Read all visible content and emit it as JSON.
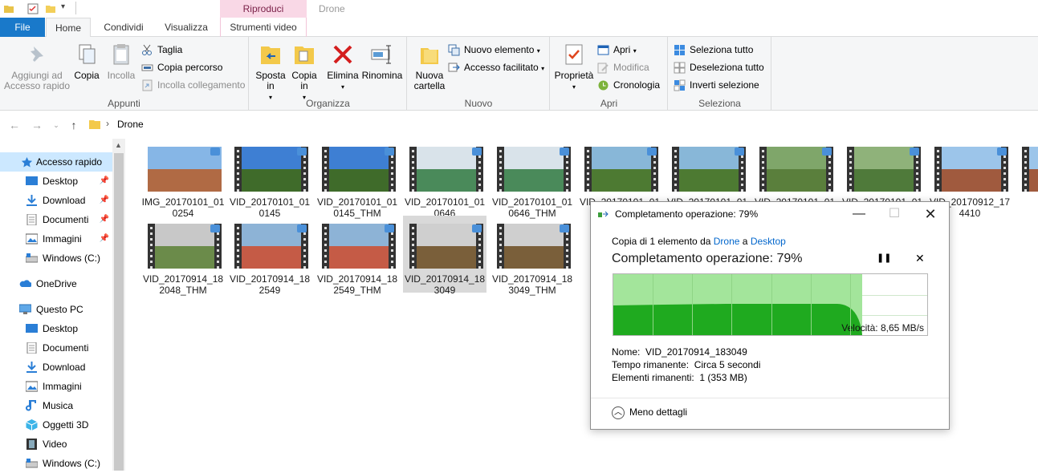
{
  "window": {
    "title": "Drone",
    "context_tab": "Riproduci"
  },
  "tabs": {
    "file": "File",
    "home": "Home",
    "share": "Condividi",
    "view": "Visualizza",
    "video_tools": "Strumenti video"
  },
  "ribbon": {
    "appunti": {
      "label": "Appunti",
      "pin": "Aggiungi ad Accesso rapido",
      "copy": "Copia",
      "paste": "Incolla",
      "cut": "Taglia",
      "copy_path": "Copia percorso",
      "paste_link": "Incolla collegamento"
    },
    "organizza": {
      "label": "Organizza",
      "move": "Sposta in",
      "copy_to": "Copia in",
      "delete": "Elimina",
      "rename": "Rinomina"
    },
    "nuovo": {
      "label": "Nuovo",
      "new_folder": "Nuova cartella",
      "new_item": "Nuovo elemento",
      "easy_access": "Accesso facilitato"
    },
    "apri": {
      "label": "Apri",
      "properties": "Proprietà",
      "open": "Apri",
      "edit": "Modifica",
      "history": "Cronologia"
    },
    "seleziona": {
      "label": "Seleziona",
      "select_all": "Seleziona tutto",
      "select_none": "Deseleziona tutto",
      "invert": "Inverti selezione"
    }
  },
  "address": {
    "path": "Drone"
  },
  "nav": {
    "quick_access": "Accesso rapido",
    "qa_items": [
      "Desktop",
      "Download",
      "Documenti",
      "Immagini",
      "Windows (C:)"
    ],
    "onedrive": "OneDrive",
    "this_pc": "Questo PC",
    "pc_items": [
      "Desktop",
      "Documenti",
      "Download",
      "Immagini",
      "Musica",
      "Oggetti 3D",
      "Video",
      "Windows (C:)"
    ]
  },
  "files": [
    "IMG_20170101_010254",
    "VID_20170101_010145",
    "VID_20170101_010145_THM",
    "VID_20170101_010646",
    "VID_20170101_010646_THM",
    "VID_20170101_01",
    "VID_20170101_01",
    "VID_20170101_01",
    "VID_20170101_01",
    "VID_20170912_174410",
    "VID_2",
    "VID_20170914_182048_THM",
    "VID_20170914_182549",
    "VID_20170914_182549_THM",
    "VID_20170914_183049",
    "VID_20170914_183049_THM"
  ],
  "dialog": {
    "title": "Completamento operazione: 79%",
    "copy_prefix": "Copia di 1 elemento da",
    "source": "Drone",
    "joiner": "a",
    "dest": "Desktop",
    "heading": "Completamento operazione: 79%",
    "progress_percent": 79,
    "speed": "Velocità: 8,65 MB/s",
    "name_label": "Nome:",
    "name_value": "VID_20170914_183049",
    "time_label": "Tempo rimanente:",
    "time_value": "Circa 5 secondi",
    "items_label": "Elementi rimanenti:",
    "items_value": "1 (353 MB)",
    "less_details": "Meno dettagli",
    "pause_icon": "pause-icon",
    "close_icon": "close-icon"
  },
  "colors": {
    "accent": "#1979ca",
    "context_tab": "#f9d8e6",
    "graph_fill": "#1faa1f",
    "graph_bg": "#a3e59b",
    "nav_selected": "#cce8ff"
  }
}
